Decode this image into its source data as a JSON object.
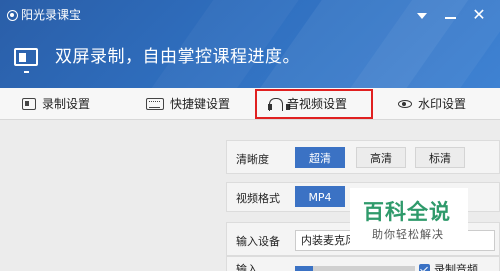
{
  "window": {
    "title": "阳光录课宝",
    "controls": [
      "menu-icon",
      "minimize-icon",
      "close-icon"
    ],
    "close_glyph": "✕"
  },
  "banner": {
    "slogan": "双屏录制，自由掌控课程进度。",
    "icon": "screen-icon",
    "gradient_colors": [
      "#2a5ea8",
      "#3f82d2"
    ]
  },
  "tabs": [
    {
      "label": "录制设置",
      "icon": "record-icon",
      "active": false
    },
    {
      "label": "快捷键设置",
      "icon": "keyboard-icon",
      "active": false
    },
    {
      "label": "音视频设置",
      "icon": "headphones-icon",
      "active": true
    },
    {
      "label": "水印设置",
      "icon": "eye-icon",
      "active": false
    }
  ],
  "highlight_color": "#e02020",
  "accent_color": "#3b72c4",
  "settings": {
    "clarity": {
      "label": "清晰度",
      "options": [
        "超清",
        "高清",
        "标清"
      ],
      "selected": "超清"
    },
    "format": {
      "label": "视频格式",
      "options": [
        "MP4"
      ],
      "selected": "MP4"
    },
    "device": {
      "label": "输入设备",
      "value": "内装麦克风"
    },
    "input": {
      "label": "输入",
      "volume_fraction": 0.15,
      "record_audio": {
        "label": "录制音频",
        "checked": true
      }
    }
  },
  "watermark": {
    "main": "百科全说",
    "sub": "助你轻松解决"
  }
}
